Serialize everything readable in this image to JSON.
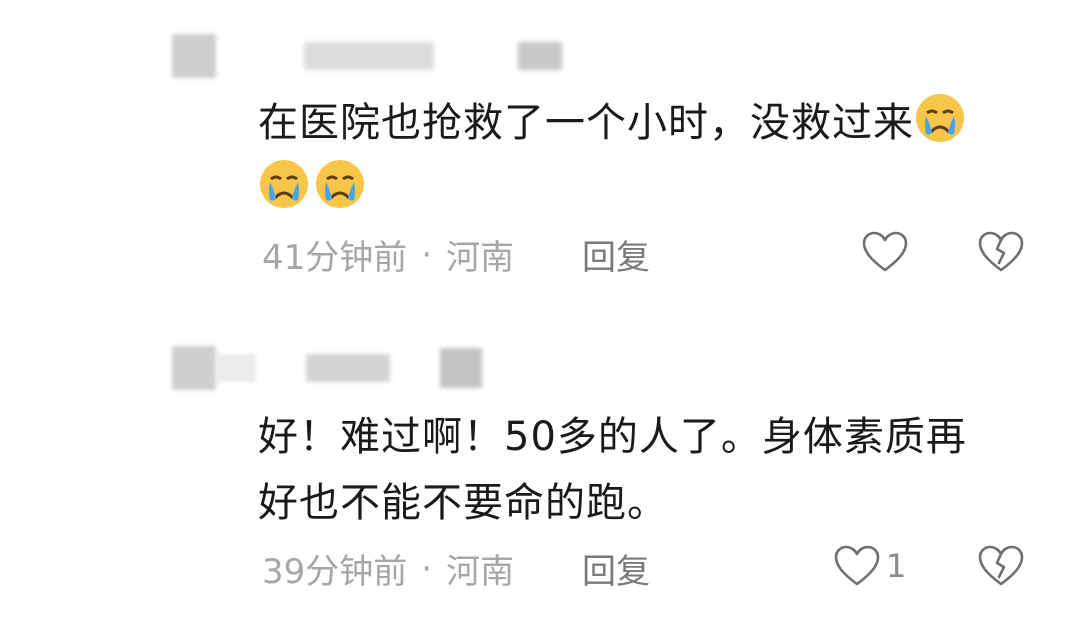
{
  "comments": [
    {
      "text": "在医院也抢救了一个小时，没救过来",
      "emoji_count_inline": 1,
      "emoji_count_second_line": 2,
      "emoji_name": "crying-face",
      "time": "41分钟前",
      "separator": "·",
      "location": "河南",
      "reply_label": "回复",
      "like_count": ""
    },
    {
      "text_line1": "好！难过啊！50多的人了。身体素质再",
      "text_line2": "好也不能不要命的跑。",
      "time": "39分钟前",
      "separator": "·",
      "location": "河南",
      "reply_label": "回复",
      "like_count": "1"
    }
  ],
  "colors": {
    "text": "#1a1a1a",
    "meta": "#a6a6a6",
    "icon_stroke": "#6f6f6f",
    "emoji_face": "#f7c548",
    "emoji_tear": "#4aa3e8"
  }
}
